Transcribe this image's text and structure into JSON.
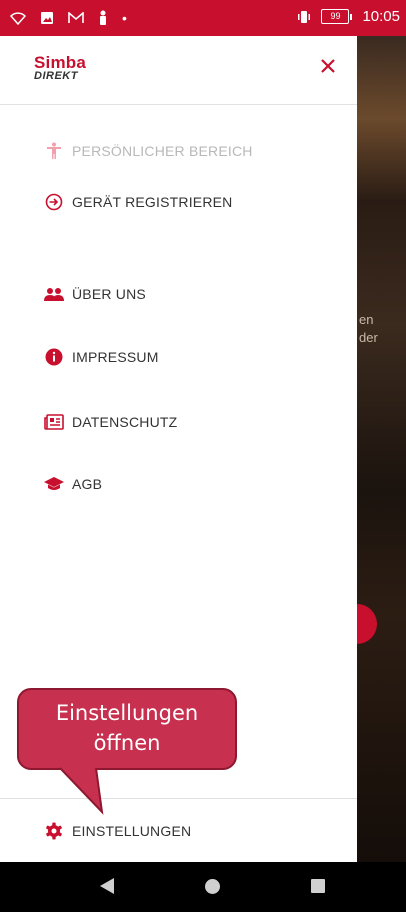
{
  "status_bar": {
    "time": "10:05",
    "battery": "99",
    "icons_left": [
      "wifi-icon",
      "image-icon",
      "gmail-icon",
      "person-icon",
      "dot-icon"
    ],
    "icons_right": [
      "vibrate-icon",
      "battery-icon"
    ]
  },
  "drawer": {
    "logo_line1": "Simba",
    "logo_line2": "DIREKT",
    "close_label": "×",
    "items": [
      {
        "label": "PERSÖNLICHER BEREICH",
        "icon": "person-accessibility-icon",
        "disabled": true
      },
      {
        "label": "GERÄT REGISTRIEREN",
        "icon": "sign-in-icon"
      },
      {
        "label": "ÜBER UNS",
        "icon": "users-icon"
      },
      {
        "label": "IMPRESSUM",
        "icon": "info-icon"
      },
      {
        "label": "DATENSCHUTZ",
        "icon": "newspaper-icon"
      },
      {
        "label": "AGB",
        "icon": "graduation-cap-icon"
      }
    ],
    "footer_item": {
      "label": "EINSTELLUNGEN",
      "icon": "gear-icon"
    }
  },
  "background_peek": {
    "line1": "en",
    "line2": "der"
  },
  "callout": {
    "line1": "Einstellungen",
    "line2": "öffnen"
  },
  "colors": {
    "accent": "#c8102e",
    "callout": "#c7304f"
  }
}
